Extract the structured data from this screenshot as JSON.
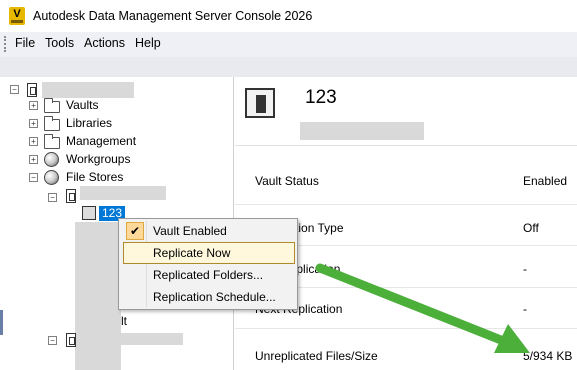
{
  "window": {
    "title": "Autodesk Data Management Server Console 2026",
    "app_icon_letter": "V"
  },
  "menubar": {
    "items": [
      "File",
      "Tools",
      "Actions",
      "Help"
    ]
  },
  "tree": {
    "vaults": "Vaults",
    "libraries": "Libraries",
    "management": "Management",
    "workgroups": "Workgroups",
    "file_stores": "File Stores",
    "selected_vault": "123",
    "partial_label": "lt"
  },
  "details": {
    "title": "123",
    "properties": [
      {
        "label": "Vault Status",
        "value": "Enabled"
      },
      {
        "label": "Replication Type",
        "value": "Off"
      },
      {
        "label": "Last Replication",
        "value": "-"
      },
      {
        "label": "Next Replication",
        "value": "-"
      },
      {
        "label": "Unreplicated Files/Size",
        "value": "5/934 KB"
      }
    ]
  },
  "context_menu": {
    "items": [
      {
        "label": "Vault Enabled",
        "checked": true
      },
      {
        "label": "Replicate Now",
        "highlighted": true
      },
      {
        "label": "Replicated Folders..."
      },
      {
        "label": "Replication Schedule..."
      }
    ]
  },
  "colors": {
    "selection": "#0078d7",
    "arrow": "#4caf3a",
    "menubar": "#eef0f5"
  }
}
